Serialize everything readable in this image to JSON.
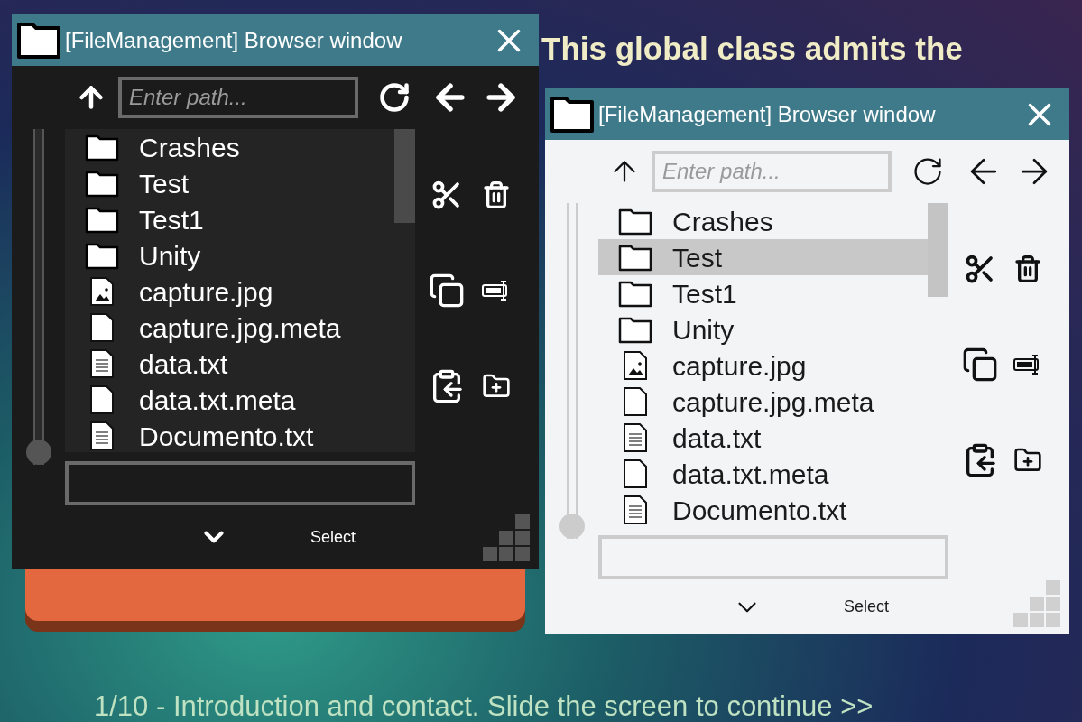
{
  "slide": {
    "heading_lines": [
      "This global class admits the"
    ],
    "footer": "1/10 - Introduction and contact. Slide the screen to continue >>"
  },
  "windows": [
    {
      "kind": "dark",
      "title": "[FileManagement] Browser window",
      "path_placeholder": "Enter path...",
      "slider": {
        "level": 0
      },
      "select_label": "Select",
      "files": [
        {
          "name": "Crashes",
          "kind": "folder",
          "selected": false
        },
        {
          "name": "Test",
          "kind": "folder",
          "selected": false
        },
        {
          "name": "Test1",
          "kind": "folder",
          "selected": false
        },
        {
          "name": "Unity",
          "kind": "folder",
          "selected": false
        },
        {
          "name": "capture.jpg",
          "kind": "image",
          "selected": false
        },
        {
          "name": "capture.jpg.meta",
          "kind": "file",
          "selected": false
        },
        {
          "name": "data.txt",
          "kind": "text",
          "selected": false
        },
        {
          "name": "data.txt.meta",
          "kind": "file",
          "selected": false
        },
        {
          "name": "Documento.txt",
          "kind": "text",
          "selected": false
        }
      ]
    },
    {
      "kind": "light",
      "title": "[FileManagement] Browser window",
      "path_placeholder": "Enter path...",
      "slider": {
        "level": 0
      },
      "select_label": "Select",
      "files": [
        {
          "name": "Crashes",
          "kind": "folder",
          "selected": false
        },
        {
          "name": "Test",
          "kind": "folder",
          "selected": true
        },
        {
          "name": "Test1",
          "kind": "folder",
          "selected": false
        },
        {
          "name": "Unity",
          "kind": "folder",
          "selected": false
        },
        {
          "name": "capture.jpg",
          "kind": "image",
          "selected": false
        },
        {
          "name": "capture.jpg.meta",
          "kind": "file",
          "selected": false
        },
        {
          "name": "data.txt",
          "kind": "text",
          "selected": false
        },
        {
          "name": "data.txt.meta",
          "kind": "file",
          "selected": false
        },
        {
          "name": "Documento.txt",
          "kind": "text",
          "selected": false
        }
      ]
    }
  ]
}
